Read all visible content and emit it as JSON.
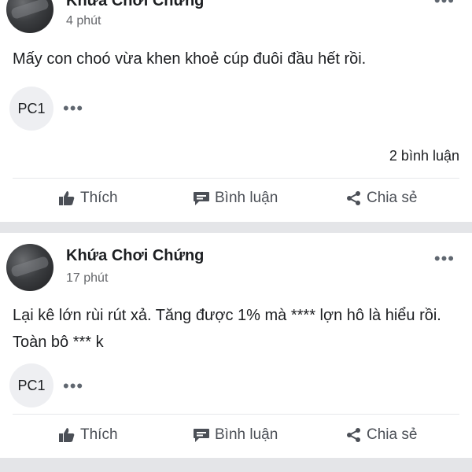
{
  "posts": [
    {
      "author": "Khứa Chơi Chứng",
      "time": "4 phút",
      "text": "Mấy con choó vừa khen khoẻ cúp đuôi đầu hết rồi.",
      "commenter_initials": "PC1",
      "comment_count": "2 bình luận",
      "actions": {
        "like": "Thích",
        "comment": "Bình luận",
        "share": "Chia sẻ"
      }
    },
    {
      "author": "Khứa Chơi Chứng",
      "time": "17 phút",
      "text": "Lại kê lớn rùi rút xả. Tăng được 1% mà **** lợn hô là hiểu rồi. Toàn bô *** k",
      "commenter_initials": "PC1",
      "actions": {
        "like": "Thích",
        "comment": "Bình luận",
        "share": "Chia sẻ"
      }
    }
  ],
  "icons": {
    "like": "thumbs-up-icon",
    "comment": "comment-bubble-icon",
    "share": "share-icon",
    "more": "more-options-icon"
  },
  "colors": {
    "separator": "#e4e5e8",
    "secondary_text": "#65676b",
    "action_text": "#4b4f56"
  }
}
